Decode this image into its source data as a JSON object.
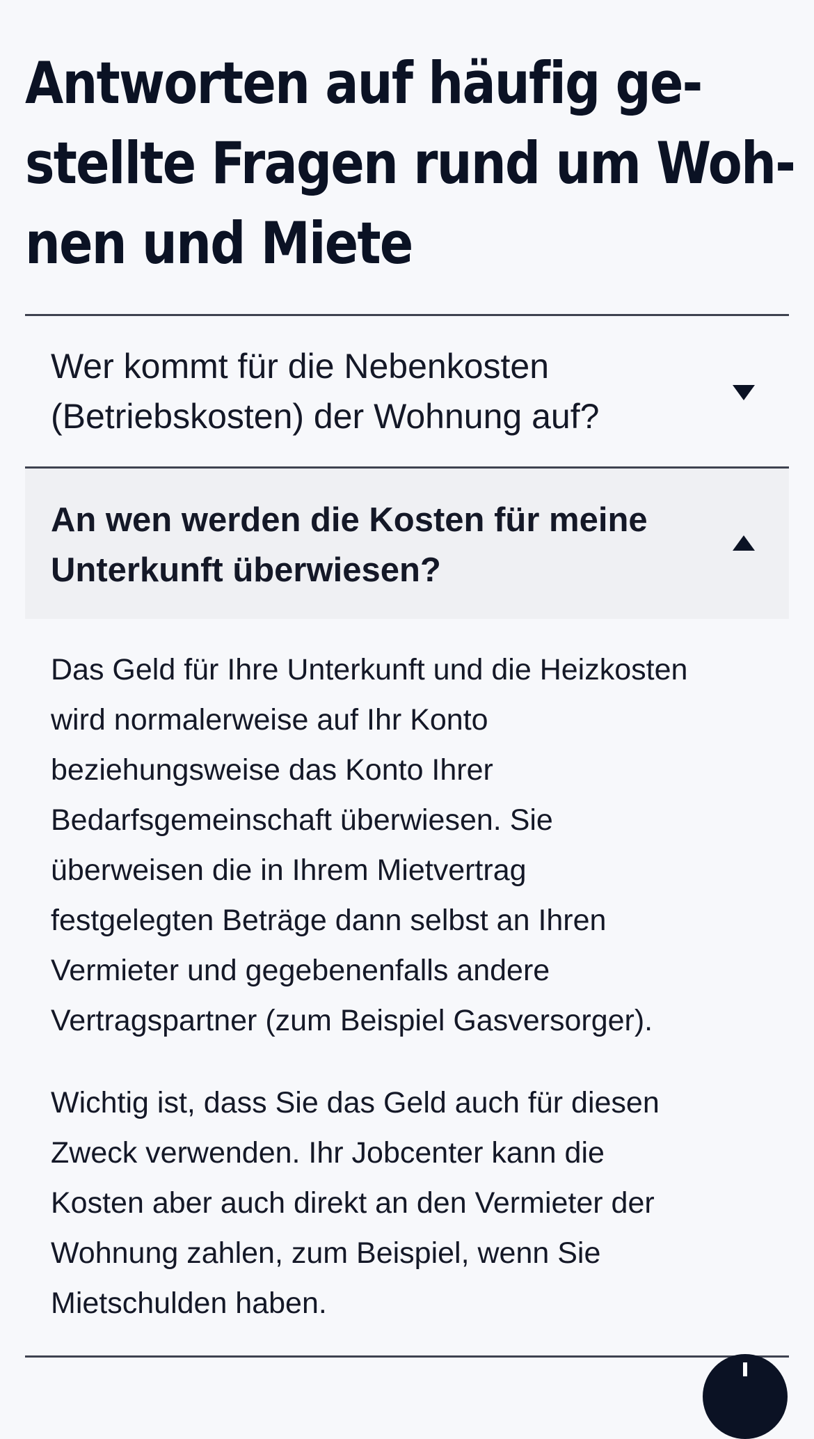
{
  "page": {
    "title_lines": [
      "Antworten auf häufig ge-",
      "stellte Fragen rund um Woh-",
      "nen und Miete"
    ]
  },
  "faq": {
    "items": [
      {
        "question_lines": [
          "Wer kommt für die Nebenkosten",
          "(Betriebskosten) der Wohnung auf?"
        ],
        "expanded": false,
        "icon": "caret-down-icon"
      },
      {
        "question_lines": [
          "An wen werden die Kosten für meine",
          "Unterkunft überwiesen?"
        ],
        "expanded": true,
        "icon": "caret-up-icon",
        "answer_paragraphs": [
          [
            "Das Geld für Ihre Unterkunft und die Heizkosten",
            "wird normalerweise auf Ihr Konto",
            "beziehungsweise das Konto Ihrer",
            "Bedarfsgemeinschaft überwiesen. Sie",
            "überweisen die in Ihrem Mietvertrag",
            "festgelegten Beträge dann selbst an Ihren",
            "Vermieter und gegebenenfalls andere",
            "Vertragspartner (zum Beispiel Gasversorger)."
          ],
          [
            "Wichtig ist, dass Sie das Geld auch für diesen",
            "Zweck verwenden. Ihr Jobcenter kann die",
            "Kosten aber auch direkt an den Vermieter der",
            "Wohnung zahlen, zum Beispiel, wenn Sie",
            "Mietschulden haben."
          ]
        ]
      }
    ]
  },
  "colors": {
    "background": "#f7f8fb",
    "text": "#0e1320",
    "expanded_row": "#eff0f3",
    "divider": "#3e4250",
    "fab": "#0b1224"
  }
}
